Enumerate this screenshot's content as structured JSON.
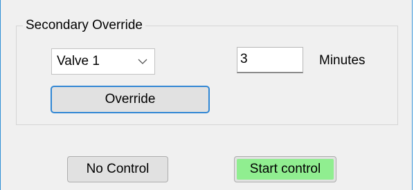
{
  "group": {
    "title": "Secondary Override"
  },
  "valve_select": {
    "value": "Valve 1",
    "icon": "chevron-down-icon"
  },
  "duration": {
    "value": "3",
    "unit_label": "Minutes"
  },
  "buttons": {
    "override": "Override",
    "no_control": "No Control",
    "start_control": "Start control"
  },
  "colors": {
    "accent_border": "#2f86d4",
    "start_control_bg": "#90ee90"
  }
}
